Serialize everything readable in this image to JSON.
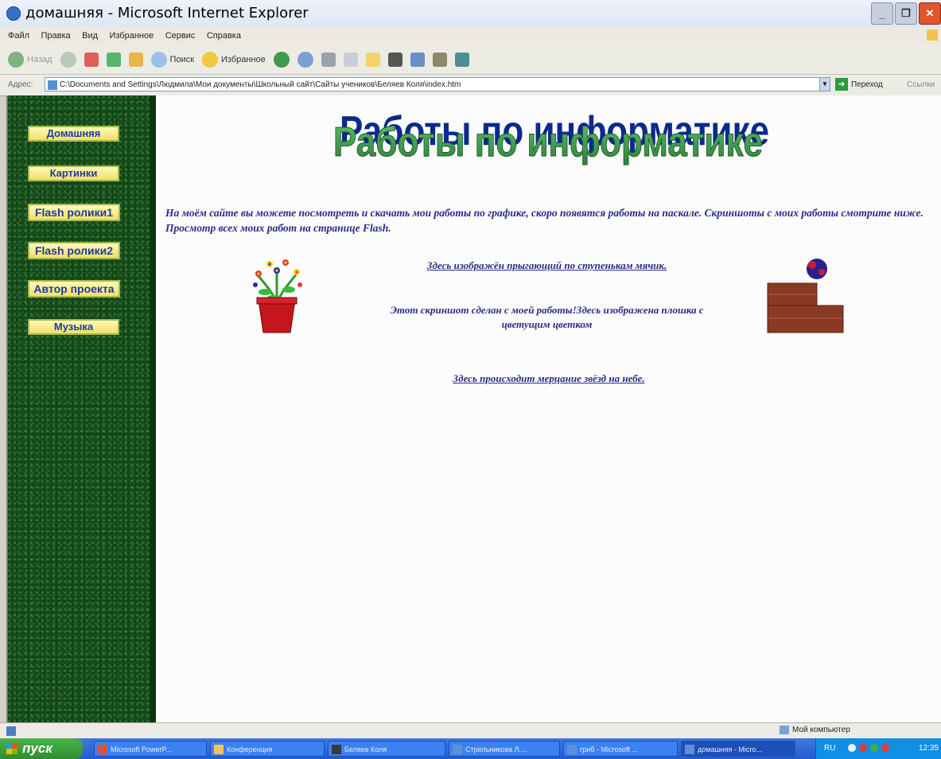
{
  "window": {
    "title": "домашняя - Microsoft Internet Explorer",
    "min_label": "_",
    "max_label": "❐",
    "close_label": "✕"
  },
  "menu": [
    "Файл",
    "Правка",
    "Вид",
    "Избранное",
    "Сервис",
    "Справка"
  ],
  "toolbar": {
    "back_label": "Назад",
    "search_label": "Поиск",
    "favorites_label": "Избранное"
  },
  "address": {
    "label": "Адрес:",
    "value": "C:\\Documents and Settings\\Людмила\\Мои документы\\Школьный сайт\\Сайты учеников\\Беляев Коля\\index.htm",
    "go_label": "Переход",
    "links_label": "Ссылки"
  },
  "sidebar": {
    "items": [
      {
        "label": "Домашняя"
      },
      {
        "label": "Картинки"
      },
      {
        "label": "Flash ролики1"
      },
      {
        "label": "Flash ролики2"
      },
      {
        "label": "Автор проекта"
      },
      {
        "label": "Музыка"
      }
    ]
  },
  "page": {
    "heading": "Работы по информатике",
    "intro": "На моём сайте вы можете посмотреть и скачать мои работы по графике, скоро появятся работы на паскале. Скриншоты с моих работы смотрите ниже. Просмотр всех моих  работ на странице  Flash.",
    "link_ball": "Здесь изображён прыгающий по ступенькам мячик.",
    "caption": "Этот скриншот сделан с моей работы!Здесь изображена плошка с цветущим цветком",
    "link_stars": "Здесь происходит мерцание звёзд на небе."
  },
  "status": {
    "zone": "Мой компьютер"
  },
  "taskbar": {
    "start_label": "пуск",
    "tasks": [
      "Microsoft PowerP...",
      "Конференция",
      "Беляев Коля",
      "Стрельникова Л....",
      "гриб - Microsoft ...",
      "домашняя - Micro..."
    ],
    "lang": "RU",
    "clock": "12:35"
  },
  "colors": {
    "link": "#2a2a8c",
    "sidebar": "#12441a",
    "nav_button": "#f0e06a",
    "heading_green": "#3a9a4a",
    "heading_blue": "#0b2a8c"
  }
}
